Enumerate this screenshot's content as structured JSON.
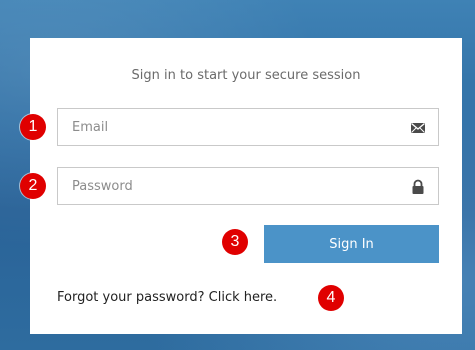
{
  "login": {
    "subtitle": "Sign in to start your secure session",
    "email": {
      "placeholder": "Email",
      "value": "",
      "icon": "envelope-icon"
    },
    "password": {
      "placeholder": "Password",
      "value": "",
      "icon": "lock-icon"
    },
    "signin_label": "Sign In",
    "forgot_text": "Forgot your password?",
    "forgot_link": "Click here."
  },
  "markers": [
    "1",
    "2",
    "3",
    "4"
  ],
  "colors": {
    "button": "#4b93c8",
    "marker": "#e00000",
    "background": "#2f6fa5"
  }
}
